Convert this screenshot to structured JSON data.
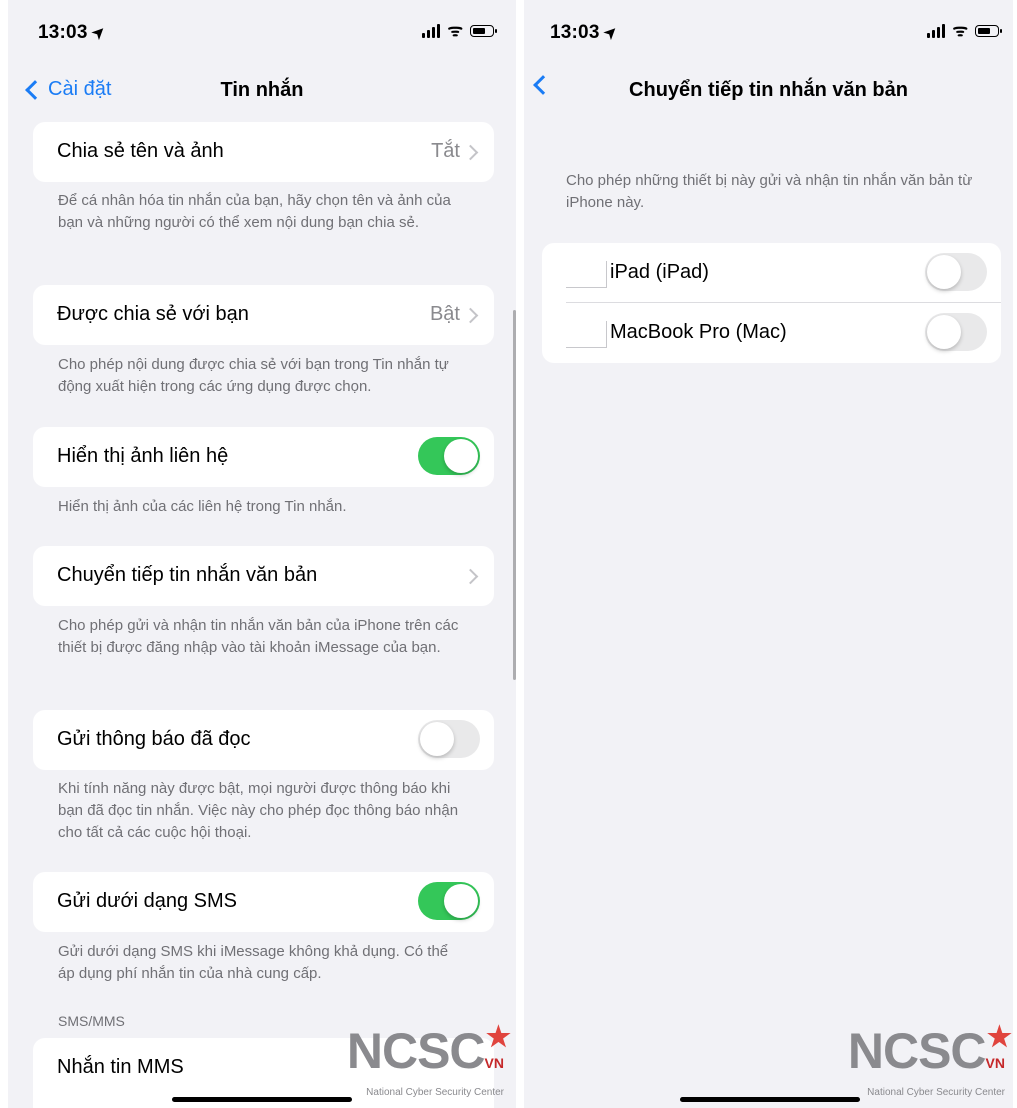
{
  "left_screen": {
    "status": {
      "time": "13:03",
      "location_icon": "location-arrow-icon"
    },
    "nav": {
      "back_label": "Cài đặt",
      "title": "Tin nhắn"
    },
    "sections": [
      {
        "label": "Chia sẻ tên và ảnh",
        "value": "Tắt",
        "footer": "Để cá nhân hóa tin nhắn của bạn, hãy chọn tên và ảnh của bạn và những người có thể xem nội dung bạn chia sẻ."
      },
      {
        "label": "Được chia sẻ với bạn",
        "value": "Bật",
        "footer": "Cho phép nội dung được chia sẻ với bạn trong Tin nhắn tự động xuất hiện trong các ứng dụng được chọn."
      },
      {
        "label": "Hiển thị ảnh liên hệ",
        "toggle": true,
        "footer": "Hiển thị ảnh của các liên hệ trong Tin nhắn."
      },
      {
        "label": "Chuyển tiếp tin nhắn văn bản",
        "value": "",
        "footer": "Cho phép gửi và nhận tin nhắn văn bản của iPhone trên các thiết bị được đăng nhập vào tài khoản iMessage của bạn."
      },
      {
        "label": "Gửi thông báo đã đọc",
        "toggle": false,
        "footer": "Khi tính năng này được bật, mọi người được thông báo khi bạn đã đọc tin nhắn. Việc này cho phép đọc thông báo nhận cho tất cả các cuộc hội thoại."
      },
      {
        "label": "Gửi dưới dạng SMS",
        "toggle": true,
        "footer": "Gửi dưới dạng SMS khi iMessage không khả dụng. Có thể áp dụng phí nhắn tin của nhà cung cấp."
      }
    ],
    "sms_header": "SMS/MMS",
    "mms_label": "Nhắn tin MMS"
  },
  "right_screen": {
    "status": {
      "time": "13:03"
    },
    "nav": {
      "title": "Chuyển tiếp tin nhắn văn bản"
    },
    "description": "Cho phép những thiết bị này gửi và nhận tin nhắn văn bản từ iPhone này.",
    "devices": [
      {
        "label": "iPad (iPad)",
        "toggle": false
      },
      {
        "label": "MacBook Pro (Mac)",
        "toggle": false
      }
    ]
  },
  "watermark": {
    "brand": "NCSC",
    "country": "VN",
    "tagline": "National Cyber Security Center"
  },
  "colors": {
    "accent": "#1a7cf5",
    "toggle_on": "#34c759",
    "toggle_off": "#e9e9ea",
    "background": "#f2f2f6"
  }
}
